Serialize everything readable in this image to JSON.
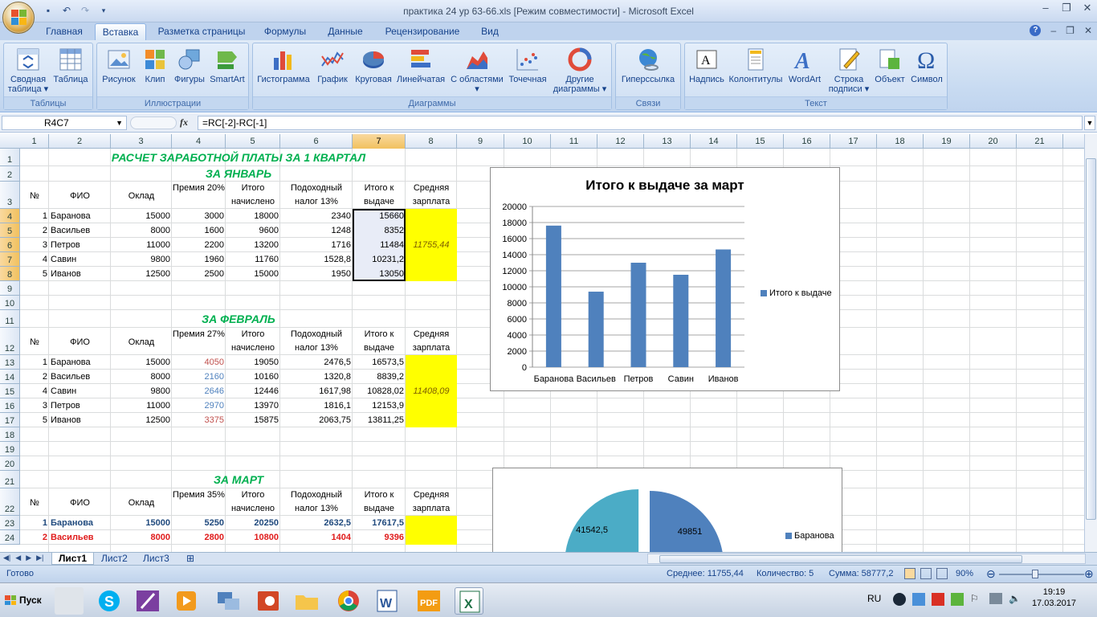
{
  "window": {
    "title": "практика 24 ур 63-66.xls  [Режим совместимости] - Microsoft Excel"
  },
  "tabs": [
    "Главная",
    "Вставка",
    "Разметка страницы",
    "Формулы",
    "Данные",
    "Рецензирование",
    "Вид"
  ],
  "active_tab": "Вставка",
  "ribbon": {
    "groups": {
      "tables": "Таблицы",
      "illustrations": "Иллюстрации",
      "charts": "Диаграммы",
      "links": "Связи",
      "text": "Текст"
    },
    "buttons": {
      "pivot": "Сводная таблица ▾",
      "table": "Таблица",
      "picture": "Рисунок",
      "clip": "Клип",
      "shapes": "Фигуры",
      "smartart": "SmartArt",
      "histogram": "Гистограмма",
      "graph": "График",
      "pie": "Круговая",
      "linear": "Линейчатая",
      "area": "С областями ▾",
      "scatter": "Точечная",
      "other": "Другие диаграммы ▾",
      "hyperlink": "Гиперссылка",
      "caption": "Надпись",
      "headers": "Колонтитулы",
      "wordart": "WordArt",
      "sigline": "Строка подписи ▾",
      "object": "Объект",
      "symbol": "Символ"
    }
  },
  "formula_bar": {
    "name_box": "R4C7",
    "formula": "=RC[-2]-RC[-1]",
    "fx": "fx"
  },
  "columns": [
    "1",
    "2",
    "3",
    "4",
    "5",
    "6",
    "7",
    "8",
    "9",
    "10",
    "11",
    "12",
    "13",
    "14",
    "15",
    "16",
    "17",
    "18",
    "19",
    "20",
    "21"
  ],
  "rows": [
    "1",
    "2",
    "3",
    "4",
    "5",
    "6",
    "7",
    "8",
    "9",
    "10",
    "11",
    "12",
    "13",
    "14",
    "15",
    "16",
    "17",
    "18",
    "19",
    "20",
    "21",
    "22",
    "23",
    "24"
  ],
  "sheet": {
    "title": "РАСЧЕТ ЗАРАБОТНОЙ ПЛАТЫ ЗА 1 КВАРТАЛ",
    "january": {
      "label": "ЗА ЯНВАРЬ",
      "headers": {
        "no": "№",
        "name": "ФИО",
        "salary": "Оклад",
        "bonus": "Премия 20%",
        "accrued": "Итого начислено",
        "tax": "Подоходный налог 13%",
        "payout": "Итого к выдаче",
        "avg": "Средняя зарплата"
      },
      "rows": [
        {
          "no": "1",
          "name": "Баранова",
          "salary": "15000",
          "bonus": "3000",
          "accrued": "18000",
          "tax": "2340",
          "payout": "15660"
        },
        {
          "no": "2",
          "name": "Васильев",
          "salary": "8000",
          "bonus": "1600",
          "accrued": "9600",
          "tax": "1248",
          "payout": "8352"
        },
        {
          "no": "3",
          "name": "Петров",
          "salary": "11000",
          "bonus": "2200",
          "accrued": "13200",
          "tax": "1716",
          "payout": "11484"
        },
        {
          "no": "4",
          "name": "Савин",
          "salary": "9800",
          "bonus": "1960",
          "accrued": "11760",
          "tax": "1528,8",
          "payout": "10231,2"
        },
        {
          "no": "5",
          "name": "Иванов",
          "salary": "12500",
          "bonus": "2500",
          "accrued": "15000",
          "tax": "1950",
          "payout": "13050"
        }
      ],
      "average": "11755,44"
    },
    "february": {
      "label": "ЗА ФЕВРАЛЬ",
      "headers": {
        "no": "№",
        "name": "ФИО",
        "salary": "Оклад",
        "bonus": "Премия 27%",
        "accrued": "Итого начислено",
        "tax": "Подоходный налог 13%",
        "payout": "Итого к выдаче",
        "avg": "Средняя зарплата"
      },
      "rows": [
        {
          "no": "1",
          "name": "Баранова",
          "salary": "15000",
          "bonus": "4050",
          "accrued": "19050",
          "tax": "2476,5",
          "payout": "16573,5"
        },
        {
          "no": "2",
          "name": "Васильев",
          "salary": "8000",
          "bonus": "2160",
          "accrued": "10160",
          "tax": "1320,8",
          "payout": "8839,2"
        },
        {
          "no": "4",
          "name": "Савин",
          "salary": "9800",
          "bonus": "2646",
          "accrued": "12446",
          "tax": "1617,98",
          "payout": "10828,02"
        },
        {
          "no": "3",
          "name": "Петров",
          "salary": "11000",
          "bonus": "2970",
          "accrued": "13970",
          "tax": "1816,1",
          "payout": "12153,9"
        },
        {
          "no": "5",
          "name": "Иванов",
          "salary": "12500",
          "bonus": "3375",
          "accrued": "15875",
          "tax": "2063,75",
          "payout": "13811,25"
        }
      ],
      "average": "11408,09"
    },
    "march": {
      "label": "ЗА МАРТ",
      "headers": {
        "no": "№",
        "name": "ФИО",
        "salary": "Оклад",
        "bonus": "Премия 35%",
        "accrued": "Итого начислено",
        "tax": "Подоходный налог 13%",
        "payout": "Итого к выдаче",
        "avg": "Средняя зарплата"
      },
      "rows": [
        {
          "no": "1",
          "name": "Баранова",
          "salary": "15000",
          "bonus": "5250",
          "accrued": "20250",
          "tax": "2632,5",
          "payout": "17617,5"
        },
        {
          "no": "2",
          "name": "Васильев",
          "salary": "8000",
          "bonus": "2800",
          "accrued": "10800",
          "tax": "1404",
          "payout": "9396"
        }
      ]
    }
  },
  "chart_data": [
    {
      "type": "bar",
      "title": "Итого к выдаче за март",
      "categories": [
        "Баранова",
        "Васильев",
        "Петров",
        "Савин",
        "Иванов"
      ],
      "series": [
        {
          "name": "Итого к выдаче",
          "values": [
            17617.5,
            9396,
            12999,
            11500,
            14650
          ]
        }
      ],
      "ylim": [
        0,
        20000
      ],
      "yticks": [
        "0",
        "2000",
        "4000",
        "6000",
        "8000",
        "10000",
        "12000",
        "14000",
        "16000",
        "18000",
        "20000"
      ],
      "legend": "right",
      "color": "#4f81bd"
    },
    {
      "type": "pie",
      "labels": [
        "41542,5",
        "49851"
      ],
      "values": [
        41542.5,
        49851
      ],
      "legend": [
        "Баранова"
      ],
      "colors": [
        "#4bacc6",
        "#4f81bd"
      ]
    }
  ],
  "sheet_tabs": [
    "Лист1",
    "Лист2",
    "Лист3"
  ],
  "active_sheet": "Лист1",
  "status": {
    "ready": "Готово",
    "average": "Среднее: 11755,44",
    "count": "Количество: 5",
    "sum": "Сумма: 58777,2",
    "zoom": "90%"
  },
  "taskbar": {
    "start": "Пуск",
    "lang": "RU",
    "time": "19:19",
    "date": "17.03.2017"
  },
  "colors": {
    "accent_green": "#00b050",
    "highlight": "#ffff00",
    "bonus_red": "#c0504d",
    "bonus_blue": "#4f81bd",
    "bar": "#4f81bd"
  }
}
